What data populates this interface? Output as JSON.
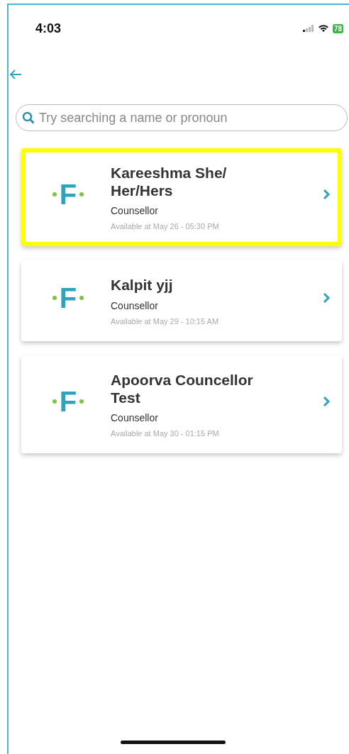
{
  "status_bar": {
    "time": "4:03",
    "battery": "78"
  },
  "search": {
    "placeholder": "Try searching a name or pronoun"
  },
  "counsellors": [
    {
      "logo_text": "F",
      "name": "Kareeshma She/ Her/Hers",
      "role": "Counsellor",
      "availability": "Available at May 26 - 05:30 PM",
      "selected": true
    },
    {
      "logo_text": "F",
      "name": "Kalpit yjj",
      "role": "Counsellor",
      "availability": "Available at May 29 - 10:15 AM",
      "selected": false
    },
    {
      "logo_text": "F",
      "name": "Apoorva Councellor Test",
      "role": "Counsellor",
      "availability": "Available at May 30 - 01:15 PM",
      "selected": false
    }
  ]
}
